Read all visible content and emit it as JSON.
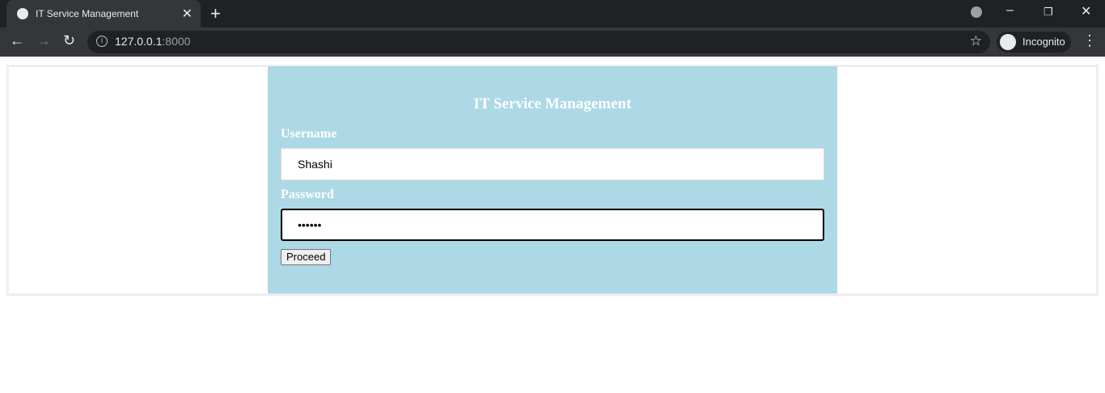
{
  "browser": {
    "tab_title": "IT Service Management",
    "url_host": "127.0.0.1",
    "url_port": ":8000",
    "profile": "Incognito"
  },
  "form": {
    "heading": "IT Service Management",
    "username_label": "Username",
    "username_value": "Shashi",
    "password_label": "Password",
    "password_value": "••••••",
    "submit_label": "Proceed"
  },
  "colors": {
    "card_bg": "#add8e6"
  }
}
